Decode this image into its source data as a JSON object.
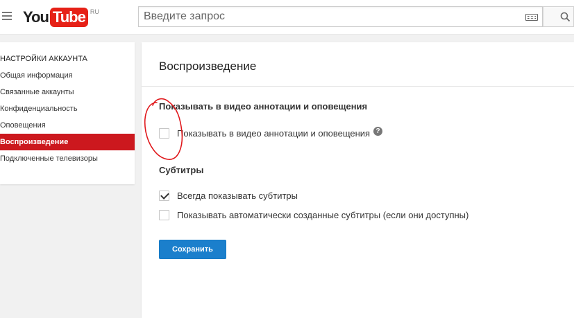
{
  "header": {
    "logo_you": "You",
    "logo_tube": "Tube",
    "logo_region": "RU",
    "search_placeholder": "Введите запрос"
  },
  "sidebar": {
    "heading": "НАСТРОЙКИ АККАУНТА",
    "items": [
      {
        "label": "Общая информация",
        "active": false
      },
      {
        "label": "Связанные аккаунты",
        "active": false
      },
      {
        "label": "Конфиденциальность",
        "active": false
      },
      {
        "label": "Оповещения",
        "active": false
      },
      {
        "label": "Воспроизведение",
        "active": true
      },
      {
        "label": "Подключенные телевизоры",
        "active": false
      }
    ]
  },
  "main": {
    "title": "Воспроизведение",
    "annotations": {
      "heading": "Показывать в видео аннотации и оповещения",
      "option_label": "Показывать в видео аннотации и оповещения",
      "option_checked": false,
      "help": "?"
    },
    "subtitles": {
      "heading": "Субтитры",
      "options": [
        {
          "label": "Всегда показывать субтитры",
          "checked": true
        },
        {
          "label": "Показывать автоматически созданные субтитры (если они доступны)",
          "checked": false
        }
      ]
    },
    "save_label": "Сохранить"
  },
  "colors": {
    "brand_red": "#e62117",
    "active_item": "#cc181e",
    "primary_button": "#1b7fcc",
    "annotation_stroke": "#e0191d"
  }
}
